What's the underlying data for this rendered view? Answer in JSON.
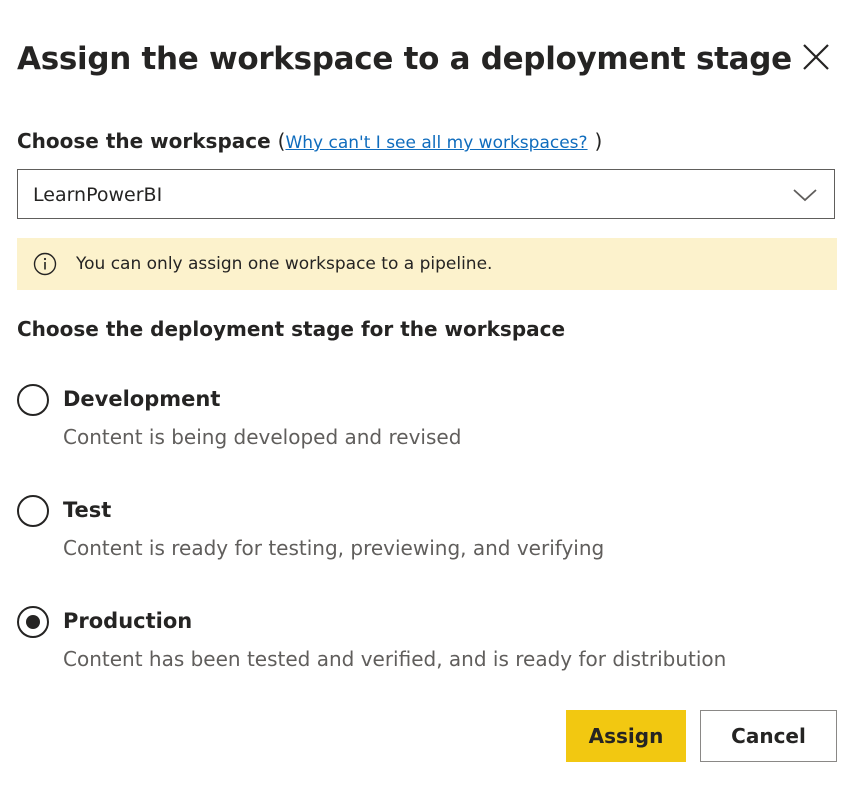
{
  "dialog": {
    "title": "Assign the workspace to a deployment stage",
    "close_icon": "close-icon"
  },
  "workspace": {
    "label": "Choose the workspace",
    "paren_open": "(",
    "paren_close": ")",
    "help_link": "Why can't I see all my workspaces?",
    "selected": "LearnPowerBI",
    "dropdown_icon": "chevron-down-icon"
  },
  "notice": {
    "icon": "info-icon",
    "text": "You can only assign one workspace to a pipeline.",
    "background": "#fcf2cc"
  },
  "stages": {
    "label": "Choose the deployment stage for the workspace",
    "options": [
      {
        "name": "Development",
        "description": "Content is being developed and revised",
        "selected": false
      },
      {
        "name": "Test",
        "description": "Content is ready for testing, previewing, and verifying",
        "selected": false
      },
      {
        "name": "Production",
        "description": "Content has been tested and verified, and is ready for distribution",
        "selected": true
      }
    ]
  },
  "buttons": {
    "assign": "Assign",
    "cancel": "Cancel",
    "assign_color": "#f2c811"
  }
}
